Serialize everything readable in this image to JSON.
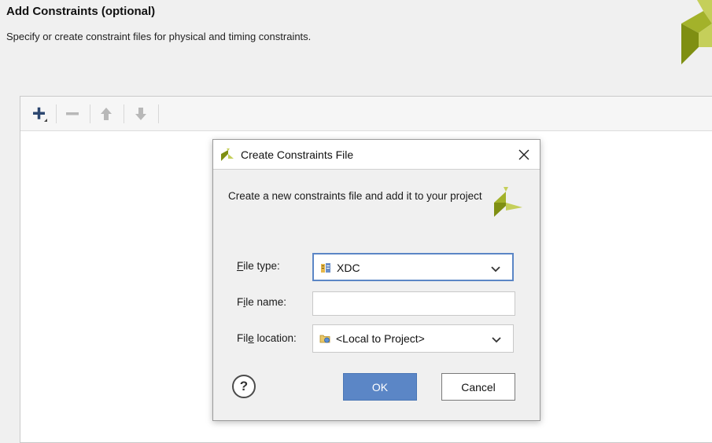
{
  "page": {
    "title": "Add Constraints (optional)",
    "subtitle": "Specify or create constraint files for physical and timing constraints."
  },
  "toolbar": {
    "buttons": [
      {
        "name": "add",
        "icon": "plus-icon"
      },
      {
        "name": "remove",
        "icon": "minus-icon"
      },
      {
        "name": "move-up",
        "icon": "arrow-up-icon"
      },
      {
        "name": "move-down",
        "icon": "arrow-down-icon"
      }
    ]
  },
  "dialog": {
    "title": "Create Constraints File",
    "description": "Create a new constraints file and add it to your project",
    "file_type": {
      "label_pre": "",
      "label_mnemonic": "F",
      "label_post": "ile type:",
      "value": "XDC",
      "icon": "xdc-file-icon"
    },
    "file_name": {
      "label_pre": "F",
      "label_mnemonic": "i",
      "label_post": "le name:",
      "value": ""
    },
    "file_location": {
      "label_pre": "Fil",
      "label_mnemonic": "e",
      "label_post": " location:",
      "value": "<Local to Project>",
      "icon": "folder-icon"
    },
    "help_label": "?",
    "ok_label": "OK",
    "cancel_label": "Cancel"
  },
  "colors": {
    "accent": "#5b86c6",
    "logo_dark": "#8a9a16",
    "logo_light": "#c5cf5a"
  }
}
